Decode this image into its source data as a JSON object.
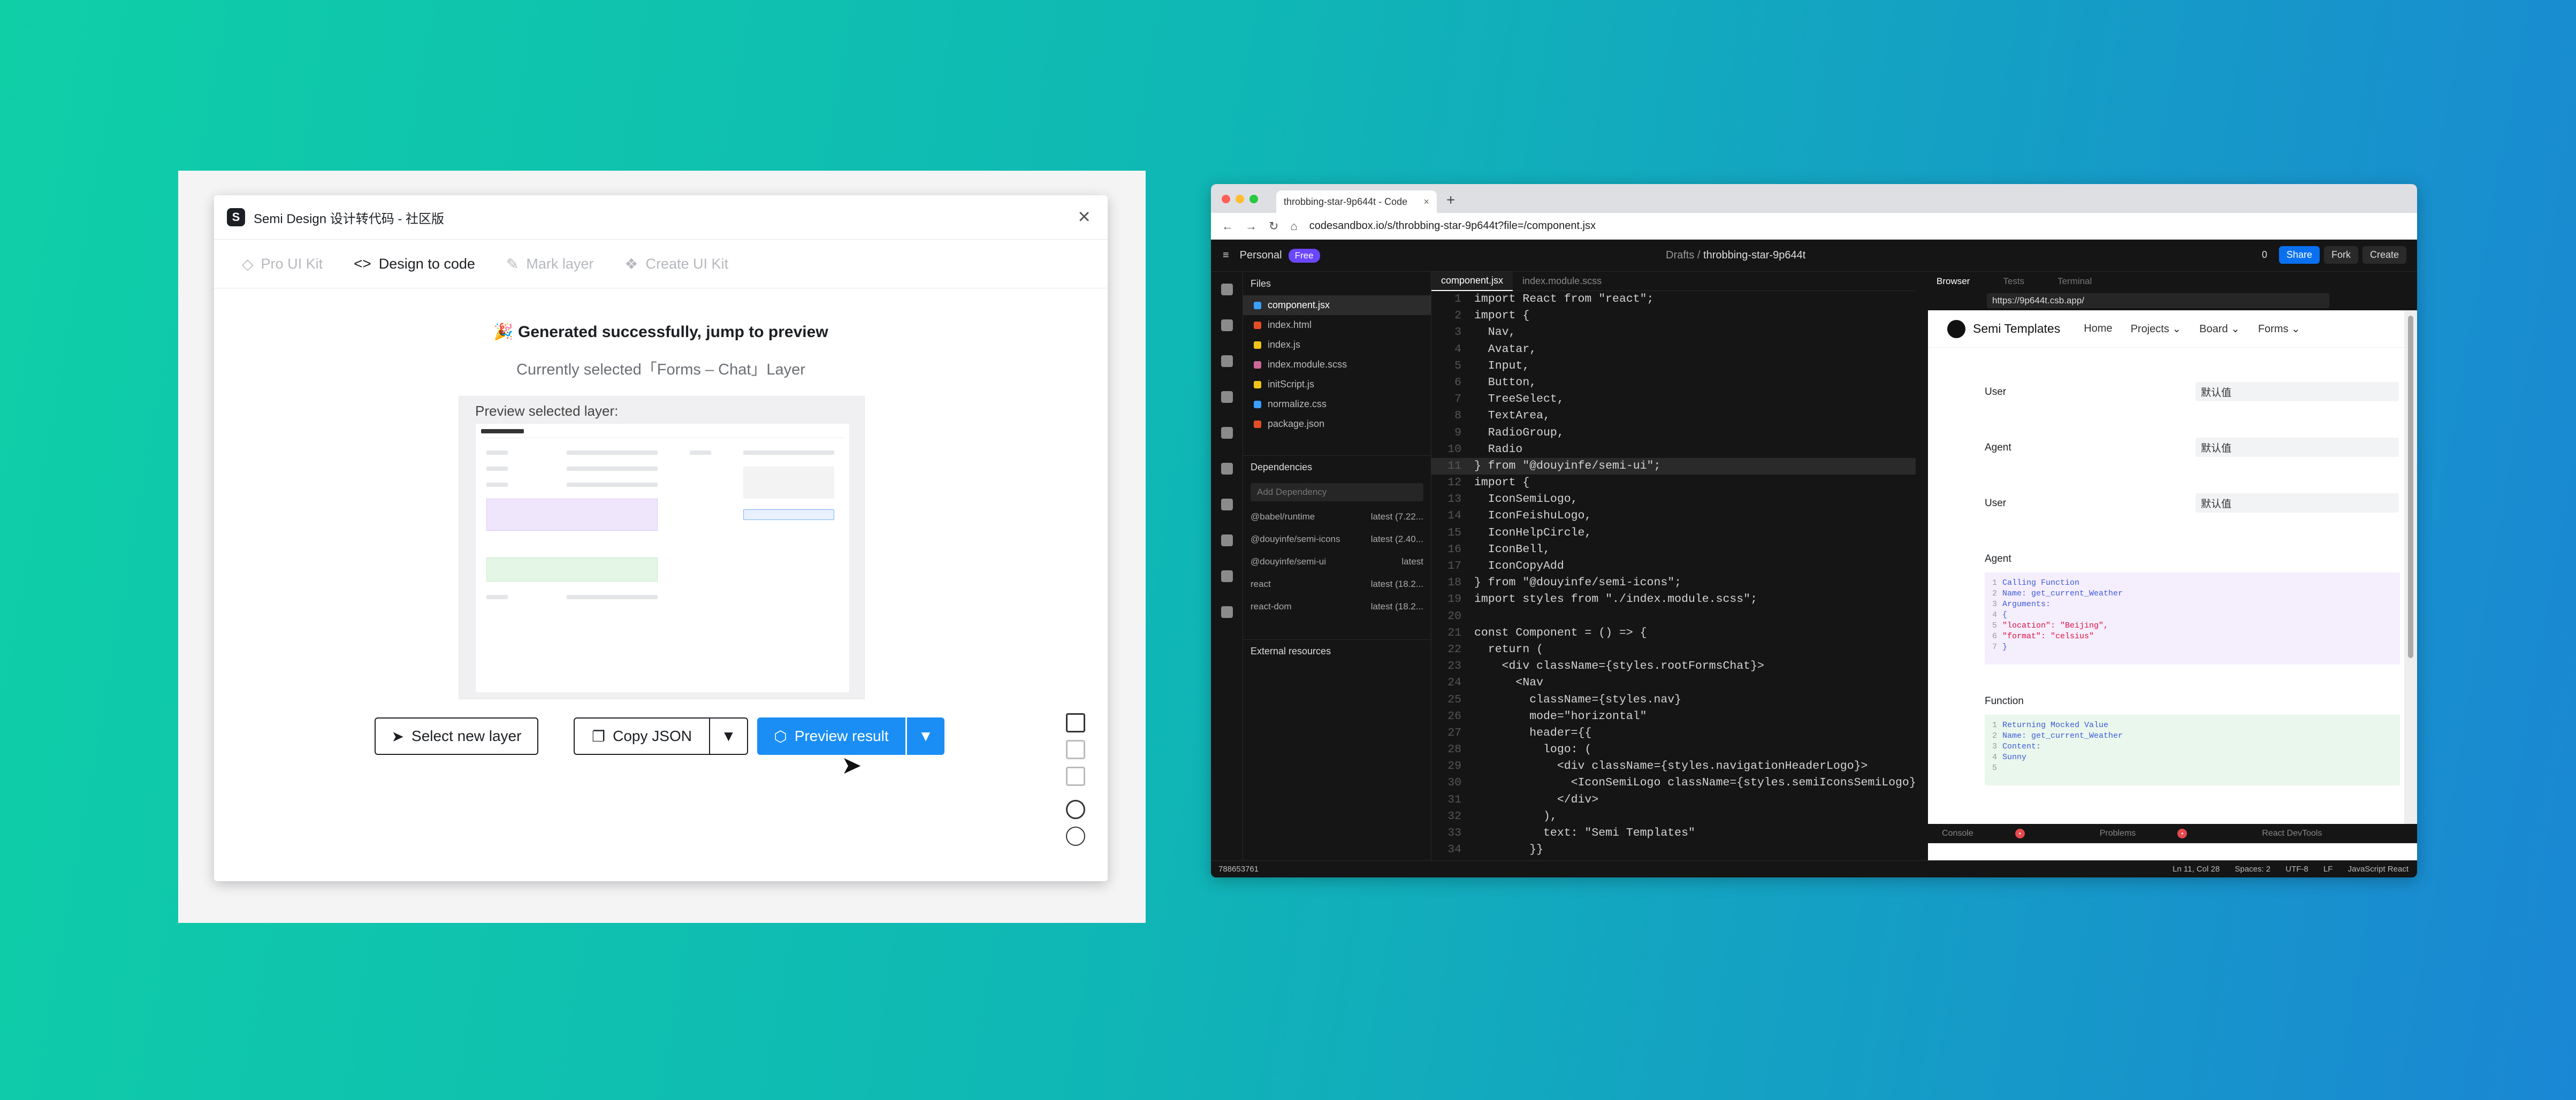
{
  "dialog": {
    "title": "Semi Design 设计转代码 - 社区版",
    "tabs": [
      "Pro UI Kit",
      "Design to code",
      "Mark layer",
      "Create UI Kit"
    ],
    "success_msg": "🎉 Generated successfully, jump to preview",
    "current_layer": "Currently selected「Forms – Chat」Layer",
    "preview_label": "Preview selected layer:",
    "buttons": {
      "select": "Select new layer",
      "copy": "Copy JSON",
      "preview": "Preview result"
    }
  },
  "browser": {
    "tab_title": "throbbing-star-9p644t - Code",
    "url": "codesandbox.io/s/throbbing-star-9p644t?file=/component.jsx",
    "workspace": "Personal",
    "plan": "Free",
    "breadcrumb_root": "Drafts",
    "breadcrumb_project": "throbbing-star-9p644t",
    "actions": [
      "0",
      "Share",
      "Fork",
      "Create"
    ],
    "files_header": "Files",
    "files": [
      "component.jsx",
      "index.html",
      "index.js",
      "index.module.scss",
      "initScript.js",
      "normalize.css",
      "package.json"
    ],
    "deps_header": "Dependencies",
    "deps_placeholder": "Add Dependency",
    "deps": [
      {
        "name": "@babel/runtime",
        "ver": "latest (7.22..."
      },
      {
        "name": "@douyinfe/semi-icons",
        "ver": "latest (2.40..."
      },
      {
        "name": "@douyinfe/semi-ui",
        "ver": "latest"
      },
      {
        "name": "react",
        "ver": "latest (18.2..."
      },
      {
        "name": "react-dom",
        "ver": "latest (18.2..."
      }
    ],
    "external": "External resources",
    "editor_tabs": [
      "component.jsx",
      "index.module.scss"
    ],
    "code": [
      "import React from \"react\";",
      "import {",
      "  Nav,",
      "  Avatar,",
      "  Input,",
      "  Button,",
      "  TreeSelect,",
      "  TextArea,",
      "  RadioGroup,",
      "  Radio",
      "} from \"@douyinfe/semi-ui\";",
      "import {",
      "  IconSemiLogo,",
      "  IconFeishuLogo,",
      "  IconHelpCircle,",
      "  IconBell,",
      "  IconCopyAdd",
      "} from \"@douyinfe/semi-icons\";",
      "import styles from \"./index.module.scss\";",
      "",
      "const Component = () => {",
      "  return (",
      "    <div className={styles.rootFormsChat}>",
      "      <Nav",
      "        className={styles.nav}",
      "        mode=\"horizontal\"",
      "        header={{",
      "          logo: (",
      "            <div className={styles.navigationHeaderLogo}>",
      "              <IconSemiLogo className={styles.semiIconsSemiLogo}",
      "            </div>",
      "          ),",
      "          text: \"Semi Templates\"",
      "        }}"
    ],
    "line_numbers": [
      "1",
      "2",
      "3",
      "4",
      "5",
      "6",
      "7",
      "8",
      "9",
      "10",
      "11",
      "12",
      "13",
      "14",
      "15",
      "16",
      "17",
      "18",
      "19",
      "20",
      "21",
      "22",
      "23",
      "24",
      "25",
      "26",
      "27",
      "28",
      "29",
      "30",
      "31",
      "32",
      "33",
      "34"
    ],
    "pane_tabs": [
      "Browser",
      "Tests",
      "Terminal"
    ],
    "pane_url": "https://9p644t.csb.app/",
    "site": {
      "brand": "Semi Templates",
      "nav": [
        "Home",
        "Projects ⌄",
        "Board ⌄",
        "Forms ⌄"
      ],
      "rows": [
        {
          "label": "User",
          "value": "默认值"
        },
        {
          "label": "Agent",
          "value": "默认值"
        },
        {
          "label": "User",
          "value": "默认值"
        }
      ],
      "agent_label": "Agent",
      "agent_code": [
        "Calling Function",
        "Name: get_current_Weather",
        "Arguments:",
        "{",
        "\"location\": \"Beijing\",",
        "\"format\": \"celsius\"",
        "}"
      ],
      "function_label": "Function",
      "function_code": [
        "Returning Mocked Value",
        "Name: get_current_Weather",
        "Content:",
        "Sunny",
        ""
      ]
    },
    "bottom": [
      "Console",
      "Problems",
      "React DevTools"
    ],
    "status_left": "788653761",
    "status_right": [
      "Ln 11, Col 28",
      "Spaces: 2",
      "UTF-8",
      "LF",
      "JavaScript React"
    ]
  }
}
